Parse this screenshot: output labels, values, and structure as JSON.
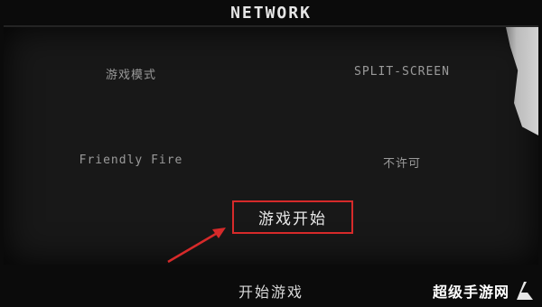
{
  "title": "NETWORK",
  "settings": [
    {
      "label": "游戏模式",
      "value": "SPLIT-SCREEN",
      "dim": false
    },
    {
      "label": "",
      "value": "",
      "dim": true
    },
    {
      "label": "",
      "value": "",
      "dim": true
    },
    {
      "label": "Friendly Fire",
      "value": "不许可",
      "dim": false
    }
  ],
  "highlight_button": "游戏开始",
  "bottom_button": "开始游戏",
  "watermark": "超级手游网",
  "colors": {
    "highlight": "#d62a2a",
    "arrow": "#d62a2a"
  }
}
